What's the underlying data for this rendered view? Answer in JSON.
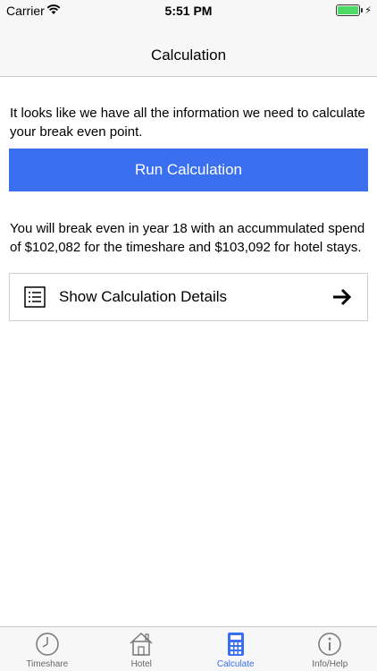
{
  "status_bar": {
    "carrier": "Carrier",
    "time": "5:51 PM"
  },
  "nav": {
    "title": "Calculation"
  },
  "intro": "It looks like we have all the information we need to calculate your break even point.",
  "run_button_label": "Run Calculation",
  "result": "You will break even in year 18 with an accummulated spend of $102,082 for the timeshare and $103,092 for hotel stays.",
  "details": {
    "label": "Show Calculation Details",
    "icon": "list-icon",
    "arrow": "arrow-right-icon"
  },
  "tabs": [
    {
      "label": "Timeshare",
      "icon": "clock-icon",
      "active": false
    },
    {
      "label": "Hotel",
      "icon": "house-icon",
      "active": false
    },
    {
      "label": "Calculate",
      "icon": "calculator-icon",
      "active": true
    },
    {
      "label": "Info/Help",
      "icon": "info-icon",
      "active": false
    }
  ],
  "colors": {
    "accent": "#3a6ff0",
    "battery": "#4cd964",
    "bar_background": "#f7f7f7"
  }
}
